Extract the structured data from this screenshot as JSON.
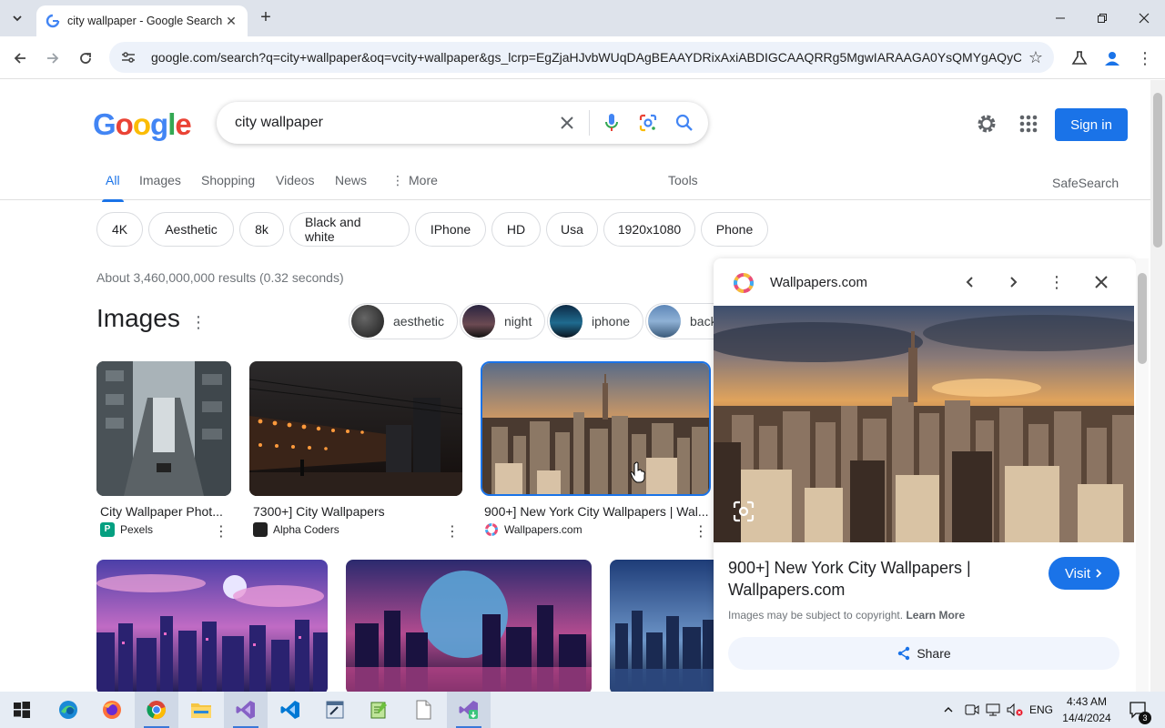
{
  "browser": {
    "tab_title": "city wallpaper - Google Search",
    "url": "google.com/search?q=city+wallpaper&oq=vcity+wallpaper&gs_lcrp=EgZjaHJvbWUqDAgBEAAYDRixAxiABDIGCAAQRRg5MgwIARAAGA0YsQMYgAQyCQg..."
  },
  "search": {
    "query": "city wallpaper",
    "signin_label": "Sign in",
    "logo_letters": [
      "G",
      "o",
      "o",
      "g",
      "l",
      "e"
    ],
    "logo_colors": [
      "#4285f4",
      "#ea4335",
      "#fbbc05",
      "#4285f4",
      "#34a853",
      "#ea4335"
    ]
  },
  "tabs": {
    "all": "All",
    "images": "Images",
    "shopping": "Shopping",
    "videos": "Videos",
    "news": "News",
    "more": "More",
    "tools": "Tools",
    "safesearch": "SafeSearch"
  },
  "chips": [
    "4K",
    "Aesthetic",
    "8k",
    "Black and white",
    "IPhone",
    "HD",
    "Usa",
    "1920x1080",
    "Phone"
  ],
  "results_stats": "About 3,460,000,000 results (0.32 seconds)",
  "images_section": {
    "heading": "Images",
    "refinements": [
      "aesthetic",
      "night",
      "iphone",
      "back"
    ],
    "cards": [
      {
        "caption": "City Wallpaper Phot...",
        "source": "Pexels"
      },
      {
        "caption": "7300+] City Wallpapers",
        "source": "Alpha Coders"
      },
      {
        "caption": "900+] New York City Wallpapers | Wal...",
        "source": "Wallpapers.com"
      }
    ]
  },
  "panel": {
    "site_name": "Wallpapers.com",
    "title": "900+] New York City Wallpapers | Wallpapers.com",
    "visit_label": "Visit",
    "copyright_text": "Images may be subject to copyright.",
    "learn_more": "Learn More",
    "share_label": "Share"
  },
  "taskbar": {
    "language": "ENG",
    "time": "4:43 AM",
    "date": "14/4/2024",
    "notifications": "3"
  },
  "colors": {
    "accent": "#1a73e8",
    "tabstrip": "#dee3eb",
    "omnibox": "#edf2fa"
  }
}
